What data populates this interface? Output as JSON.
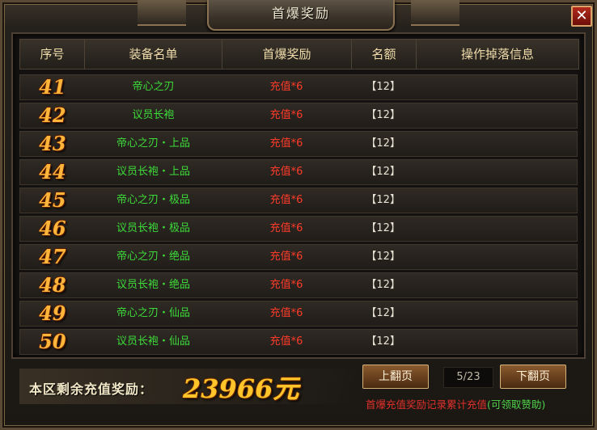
{
  "window": {
    "title": "首爆奖励",
    "close_label": "✕"
  },
  "table": {
    "headers": [
      "序号",
      "装备名单",
      "首爆奖励",
      "名额",
      "操作掉落信息"
    ],
    "rows": [
      {
        "index": "41",
        "item": "帝心之刃",
        "reward": "充值*6",
        "quota": "【12】",
        "info": ""
      },
      {
        "index": "42",
        "item": "议员长袍",
        "reward": "充值*6",
        "quota": "【12】",
        "info": ""
      },
      {
        "index": "43",
        "item": "帝心之刃・上品",
        "reward": "充值*6",
        "quota": "【12】",
        "info": ""
      },
      {
        "index": "44",
        "item": "议员长袍・上品",
        "reward": "充值*6",
        "quota": "【12】",
        "info": ""
      },
      {
        "index": "45",
        "item": "帝心之刃・极品",
        "reward": "充值*6",
        "quota": "【12】",
        "info": ""
      },
      {
        "index": "46",
        "item": "议员长袍・极品",
        "reward": "充值*6",
        "quota": "【12】",
        "info": ""
      },
      {
        "index": "47",
        "item": "帝心之刃・绝品",
        "reward": "充值*6",
        "quota": "【12】",
        "info": ""
      },
      {
        "index": "48",
        "item": "议员长袍・绝品",
        "reward": "充值*6",
        "quota": "【12】",
        "info": ""
      },
      {
        "index": "49",
        "item": "帝心之刃・仙品",
        "reward": "充值*6",
        "quota": "【12】",
        "info": ""
      },
      {
        "index": "50",
        "item": "议员长袍・仙品",
        "reward": "充值*6",
        "quota": "【12】",
        "info": ""
      }
    ]
  },
  "footer": {
    "remain_label": "本区剩余充值奖励：",
    "remain_value": "23966元",
    "prev_label": "上翻页",
    "next_label": "下翻页",
    "page": "5/23",
    "note_red": "首爆充值奖励记录累计充值",
    "note_green": "(可领取赞助)"
  },
  "colors": {
    "item_name": "#3ddc3a",
    "reward": "#ff3b2a",
    "index": "#ffb43a",
    "header_text": "#f0dcaa"
  }
}
